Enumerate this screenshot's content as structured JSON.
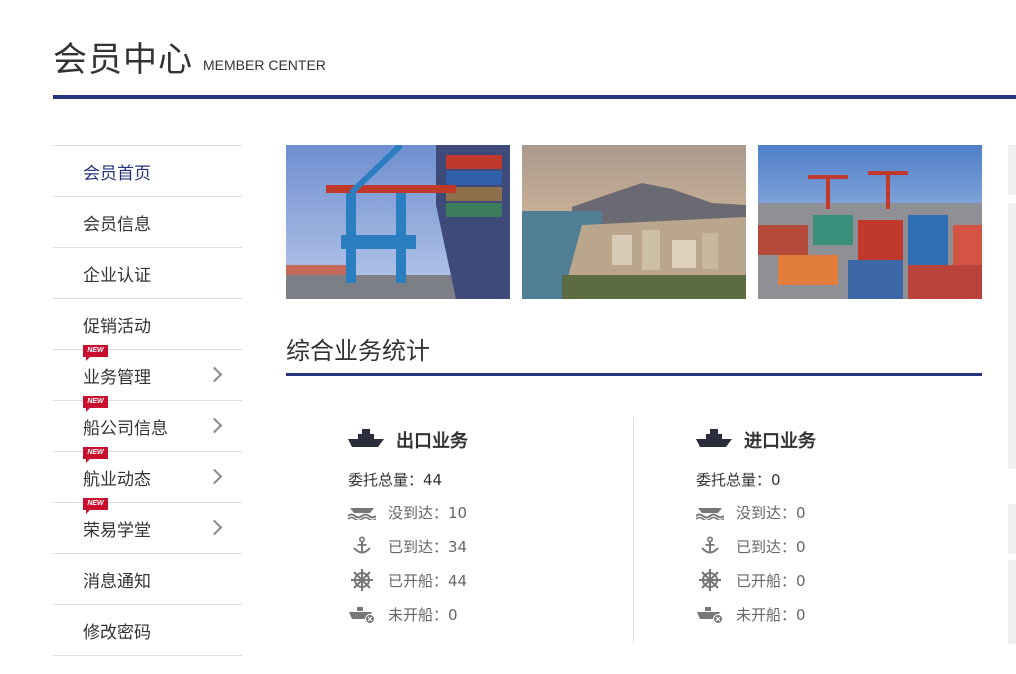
{
  "header": {
    "title": "会员中心",
    "subtitle": "MEMBER CENTER"
  },
  "sidebar": {
    "items": [
      {
        "label": "会员首页",
        "active": true
      },
      {
        "label": "会员信息"
      },
      {
        "label": "企业认证"
      },
      {
        "label": "促销活动"
      },
      {
        "label": "业务管理",
        "badge": "NEW",
        "has_submenu": true
      },
      {
        "label": "船公司信息",
        "badge": "NEW",
        "has_submenu": true
      },
      {
        "label": "航业动态",
        "badge": "NEW",
        "has_submenu": true
      },
      {
        "label": "荣易学堂",
        "badge": "NEW",
        "has_submenu": true
      },
      {
        "label": "消息通知"
      },
      {
        "label": "修改密码"
      }
    ]
  },
  "banner": {
    "images": [
      "port-crane-photo",
      "coastal-city-photo",
      "container-yard-photo"
    ]
  },
  "stats": {
    "title": "综合业务统计",
    "export": {
      "title": "出口业务",
      "total_label": "委托总量：44",
      "rows": [
        {
          "icon": "ship-waves-icon",
          "text": "没到达：10"
        },
        {
          "icon": "anchor-icon",
          "text": "已到达：34"
        },
        {
          "icon": "ship-wheel-icon",
          "text": "已开船：44"
        },
        {
          "icon": "ship-not-sailed-icon",
          "text": "未开船：0"
        }
      ]
    },
    "import": {
      "title": "进口业务",
      "total_label": "委托总量：0",
      "rows": [
        {
          "icon": "ship-waves-icon",
          "text": "没到达：0"
        },
        {
          "icon": "anchor-icon",
          "text": "已到达：0"
        },
        {
          "icon": "ship-wheel-icon",
          "text": "已开船：0"
        },
        {
          "icon": "ship-not-sailed-icon",
          "text": "未开船：0"
        }
      ]
    }
  },
  "colors": {
    "accent": "#26337a",
    "badge": "#c8102e"
  }
}
